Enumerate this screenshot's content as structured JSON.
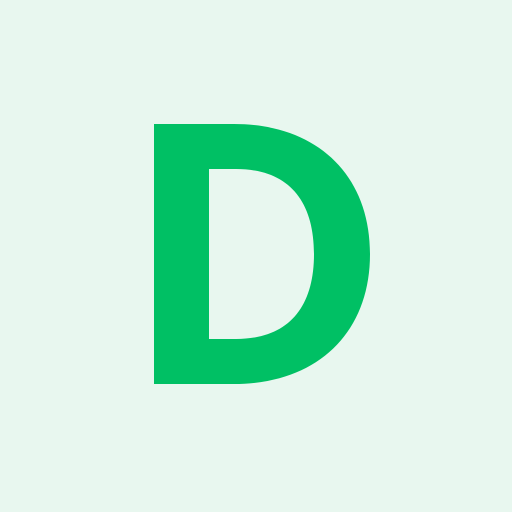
{
  "logo": {
    "letter": "D",
    "color": "#00c064",
    "background_color": "#e8f7ef"
  }
}
